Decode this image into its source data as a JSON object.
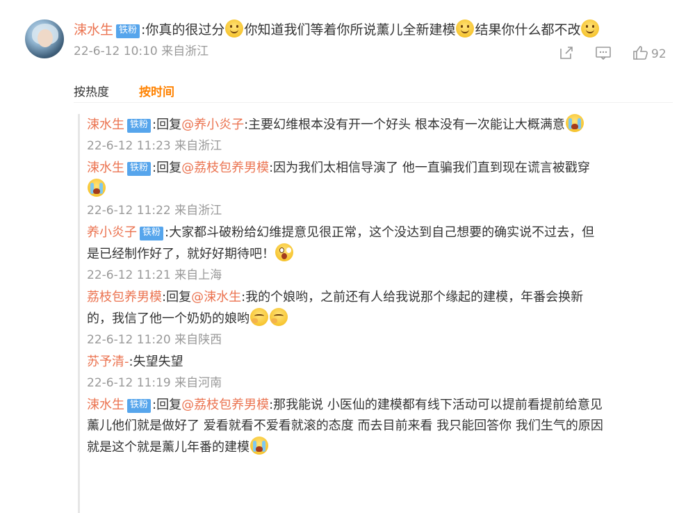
{
  "main": {
    "author": "涑水生",
    "badge": "铁粉",
    "text_1": ":你真的很过分",
    "text_2": "你知道我们等着你所说薰儿全新建模",
    "text_3": "结果你什么都不改",
    "timestamp": "22-6-12 10:10 来自浙江",
    "like_count": "92",
    "icons": [
      "share-icon",
      "comment-icon",
      "like-icon"
    ]
  },
  "sort": {
    "heat": "按热度",
    "time": "按时间"
  },
  "replies": [
    {
      "author": "涑水生",
      "badge": "铁粉",
      "reply_word": ":回复",
      "mention": "@养小炎子",
      "text": ":主要幻维根本没有开一个好头 根本没有一次能让大概满意",
      "meta": "22-6-12 11:23 来自浙江"
    },
    {
      "author": "涑水生",
      "badge": "铁粉",
      "reply_word": ":回复",
      "mention": "@荔枝包养男模",
      "text": ":因为我们太相信导演了 他一直骗我们直到现在谎言被戳穿",
      "meta": "22-6-12 11:22 来自浙江"
    },
    {
      "author": "养小炎子",
      "badge": "铁粉",
      "text_1": ":大家都斗破粉给幻维提意见很正常，这个没达到自己想要的确实说不过去，但",
      "text_2": "是已经制作好了，就好好期待吧！",
      "meta": "22-6-12 11:21 来自上海"
    },
    {
      "author": "荔枝包养男模",
      "reply_word": ":回复",
      "mention": "@涑水生",
      "text_1": ":我的个娘哟，之前还有人给我说那个缘起的建模，年番会换新",
      "text_2": "的，我信了他一个奶奶的娘哟",
      "meta": "22-6-12 11:20 来自陕西"
    },
    {
      "author": "苏予清-",
      "text": ":失望失望",
      "meta": "22-6-12 11:19 来自河南"
    },
    {
      "author": "涑水生",
      "badge": "铁粉",
      "reply_word": ":回复",
      "mention": "@荔枝包养男模",
      "text_1": ":那我能说 小医仙的建模都有线下活动可以提前看提前给意见",
      "text_2": "薰儿他们就是做好了 爱看就看不爱看就滚的态度 而去目前来看 我只能回答你 我们生气的原因",
      "text_3": "就是这个就是薰儿年番的建模"
    }
  ]
}
